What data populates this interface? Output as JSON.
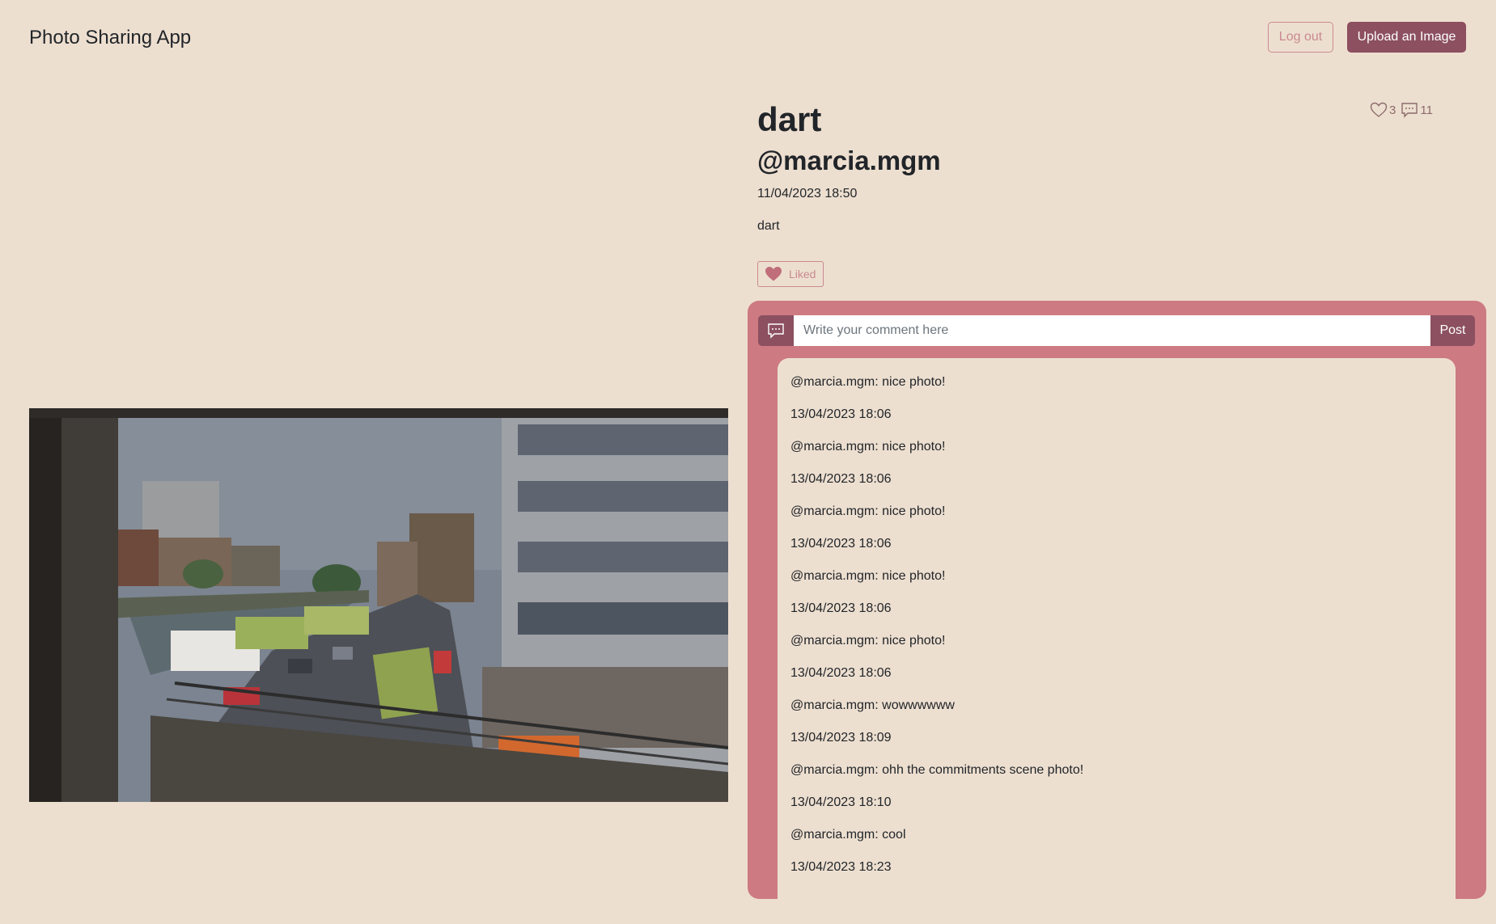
{
  "app": {
    "title": "Photo Sharing App",
    "logout_label": "Log out",
    "upload_label": "Upload an Image"
  },
  "post": {
    "title": "dart",
    "author": "@marcia.mgm",
    "date": "11/04/2023 18:50",
    "description": "dart",
    "like_count": "3",
    "comment_count": "11",
    "liked_label": "Liked",
    "photo_description_icon": "photo"
  },
  "comment_form": {
    "placeholder": "Write your comment here",
    "value": "",
    "post_label": "Post",
    "icon": "comment-icon"
  },
  "comments": [
    {
      "text": "@marcia.mgm: nice photo!",
      "date": "13/04/2023 18:06"
    },
    {
      "text": "@marcia.mgm: nice photo!",
      "date": "13/04/2023 18:06"
    },
    {
      "text": "@marcia.mgm: nice photo!",
      "date": "13/04/2023 18:06"
    },
    {
      "text": "@marcia.mgm: nice photo!",
      "date": "13/04/2023 18:06"
    },
    {
      "text": "@marcia.mgm: nice photo!",
      "date": "13/04/2023 18:06"
    },
    {
      "text": "@marcia.mgm: wowwwwww",
      "date": "13/04/2023 18:09"
    },
    {
      "text": "@marcia.mgm: ohh the commitments scene photo!",
      "date": "13/04/2023 18:10"
    },
    {
      "text": "@marcia.mgm: cool",
      "date": "13/04/2023 18:23"
    }
  ],
  "colors": {
    "background": "#eddfd0",
    "accent": "#8c5060",
    "panel": "#cd7a82",
    "outline": "#c98a90"
  }
}
